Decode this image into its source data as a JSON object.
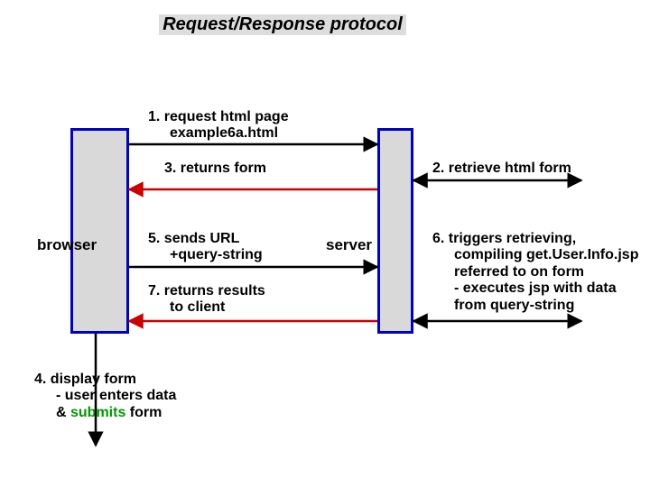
{
  "title": "Request/Response protocol",
  "boxes": {
    "browser_label": "browser",
    "server_label": "server"
  },
  "steps": {
    "s1_a": "1. request html page",
    "s1_b": "example6a.html",
    "s2": "2. retrieve html form",
    "s3": "3. returns form",
    "s4_a": "4. display form",
    "s4_b": "- user enters data",
    "s4_c": "& ",
    "s4_c_green": "submits",
    "s4_c_end": " form",
    "s5_a": "5. sends URL",
    "s5_b": "+query-string",
    "s6_a": "6. triggers retrieving,",
    "s6_b": "compiling get.User.Info.jsp",
    "s6_c": "referred to on form",
    "s6_d": "- executes jsp with data",
    "s6_e": "from query-string",
    "s7_a": "7. returns results",
    "s7_b": "to client"
  },
  "colors": {
    "arrow_red": "#cc0000",
    "arrow_black": "#000000",
    "box_border": "#0000cc",
    "box_fill": "#d9d9d9",
    "green": "#009900"
  }
}
